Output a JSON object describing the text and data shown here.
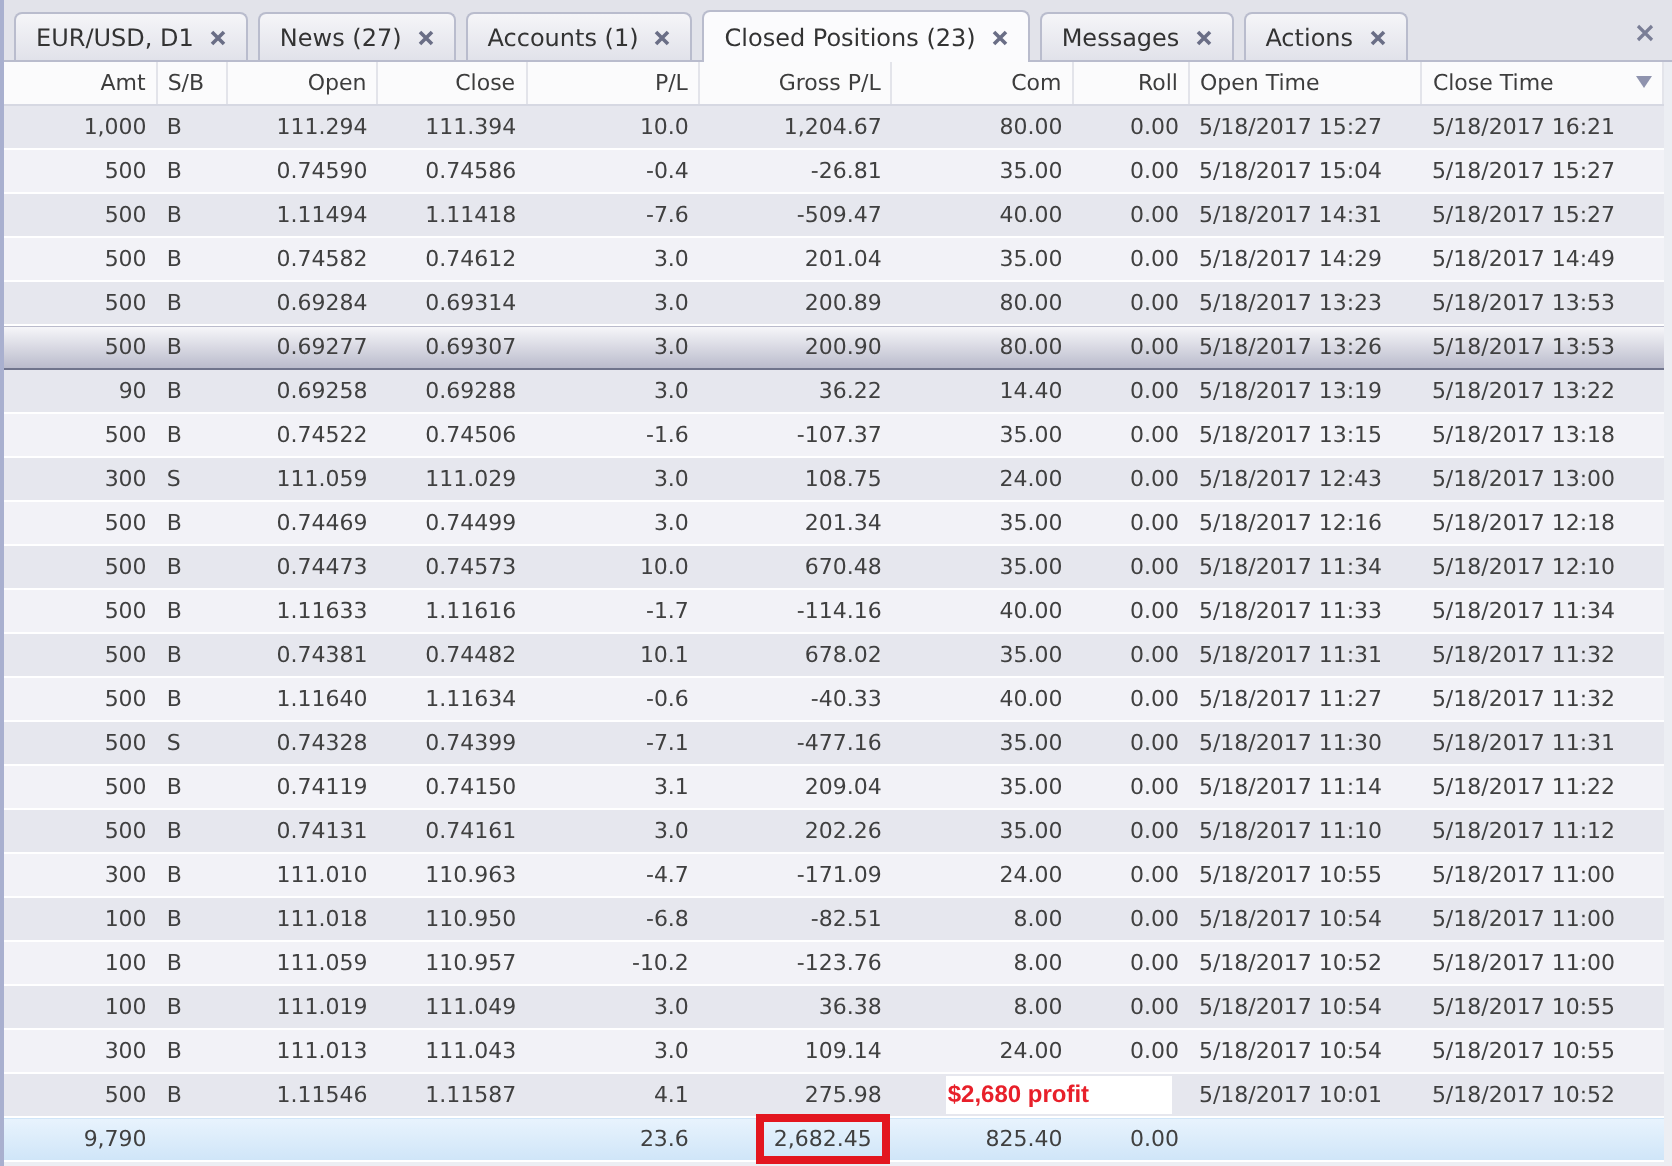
{
  "tabs": [
    {
      "label": "EUR/USD, D1",
      "selected": false
    },
    {
      "label": "News (27)",
      "selected": false
    },
    {
      "label": "Accounts (1)",
      "selected": false
    },
    {
      "label": "Closed Positions (23)",
      "selected": true
    },
    {
      "label": "Messages",
      "selected": false
    },
    {
      "label": "Actions",
      "selected": false
    }
  ],
  "table": {
    "columns": [
      {
        "label": "Amt",
        "sorted": false
      },
      {
        "label": "S/B",
        "sorted": false
      },
      {
        "label": "Open",
        "sorted": false
      },
      {
        "label": "Close",
        "sorted": false
      },
      {
        "label": "P/L",
        "sorted": false
      },
      {
        "label": "Gross P/L",
        "sorted": false
      },
      {
        "label": "Com",
        "sorted": false
      },
      {
        "label": "Roll",
        "sorted": false
      },
      {
        "label": "Open Time",
        "sorted": false
      },
      {
        "label": "Close Time",
        "sorted": true
      }
    ],
    "rows": [
      {
        "amt": "1,000",
        "side": "B",
        "open": "111.294",
        "close": "111.394",
        "pl": "10.0",
        "gross_pl": "1,204.67",
        "com": "80.00",
        "roll": "0.00",
        "open_time": "5/18/2017 15:27",
        "close_time": "5/18/2017 16:21",
        "selected": false
      },
      {
        "amt": "500",
        "side": "B",
        "open": "0.74590",
        "close": "0.74586",
        "pl": "-0.4",
        "gross_pl": "-26.81",
        "com": "35.00",
        "roll": "0.00",
        "open_time": "5/18/2017 15:04",
        "close_time": "5/18/2017 15:27",
        "selected": false
      },
      {
        "amt": "500",
        "side": "B",
        "open": "1.11494",
        "close": "1.11418",
        "pl": "-7.6",
        "gross_pl": "-509.47",
        "com": "40.00",
        "roll": "0.00",
        "open_time": "5/18/2017 14:31",
        "close_time": "5/18/2017 15:27",
        "selected": false
      },
      {
        "amt": "500",
        "side": "B",
        "open": "0.74582",
        "close": "0.74612",
        "pl": "3.0",
        "gross_pl": "201.04",
        "com": "35.00",
        "roll": "0.00",
        "open_time": "5/18/2017 14:29",
        "close_time": "5/18/2017 14:49",
        "selected": false
      },
      {
        "amt": "500",
        "side": "B",
        "open": "0.69284",
        "close": "0.69314",
        "pl": "3.0",
        "gross_pl": "200.89",
        "com": "80.00",
        "roll": "0.00",
        "open_time": "5/18/2017 13:23",
        "close_time": "5/18/2017 13:53",
        "selected": false
      },
      {
        "amt": "500",
        "side": "B",
        "open": "0.69277",
        "close": "0.69307",
        "pl": "3.0",
        "gross_pl": "200.90",
        "com": "80.00",
        "roll": "0.00",
        "open_time": "5/18/2017 13:26",
        "close_time": "5/18/2017 13:53",
        "selected": true
      },
      {
        "amt": "90",
        "side": "B",
        "open": "0.69258",
        "close": "0.69288",
        "pl": "3.0",
        "gross_pl": "36.22",
        "com": "14.40",
        "roll": "0.00",
        "open_time": "5/18/2017 13:19",
        "close_time": "5/18/2017 13:22",
        "selected": false
      },
      {
        "amt": "500",
        "side": "B",
        "open": "0.74522",
        "close": "0.74506",
        "pl": "-1.6",
        "gross_pl": "-107.37",
        "com": "35.00",
        "roll": "0.00",
        "open_time": "5/18/2017 13:15",
        "close_time": "5/18/2017 13:18",
        "selected": false
      },
      {
        "amt": "300",
        "side": "S",
        "open": "111.059",
        "close": "111.029",
        "pl": "3.0",
        "gross_pl": "108.75",
        "com": "24.00",
        "roll": "0.00",
        "open_time": "5/18/2017 12:43",
        "close_time": "5/18/2017 13:00",
        "selected": false
      },
      {
        "amt": "500",
        "side": "B",
        "open": "0.74469",
        "close": "0.74499",
        "pl": "3.0",
        "gross_pl": "201.34",
        "com": "35.00",
        "roll": "0.00",
        "open_time": "5/18/2017 12:16",
        "close_time": "5/18/2017 12:18",
        "selected": false
      },
      {
        "amt": "500",
        "side": "B",
        "open": "0.74473",
        "close": "0.74573",
        "pl": "10.0",
        "gross_pl": "670.48",
        "com": "35.00",
        "roll": "0.00",
        "open_time": "5/18/2017 11:34",
        "close_time": "5/18/2017 12:10",
        "selected": false
      },
      {
        "amt": "500",
        "side": "B",
        "open": "1.11633",
        "close": "1.11616",
        "pl": "-1.7",
        "gross_pl": "-114.16",
        "com": "40.00",
        "roll": "0.00",
        "open_time": "5/18/2017 11:33",
        "close_time": "5/18/2017 11:34",
        "selected": false
      },
      {
        "amt": "500",
        "side": "B",
        "open": "0.74381",
        "close": "0.74482",
        "pl": "10.1",
        "gross_pl": "678.02",
        "com": "35.00",
        "roll": "0.00",
        "open_time": "5/18/2017 11:31",
        "close_time": "5/18/2017 11:32",
        "selected": false
      },
      {
        "amt": "500",
        "side": "B",
        "open": "1.11640",
        "close": "1.11634",
        "pl": "-0.6",
        "gross_pl": "-40.33",
        "com": "40.00",
        "roll": "0.00",
        "open_time": "5/18/2017 11:27",
        "close_time": "5/18/2017 11:32",
        "selected": false
      },
      {
        "amt": "500",
        "side": "S",
        "open": "0.74328",
        "close": "0.74399",
        "pl": "-7.1",
        "gross_pl": "-477.16",
        "com": "35.00",
        "roll": "0.00",
        "open_time": "5/18/2017 11:30",
        "close_time": "5/18/2017 11:31",
        "selected": false
      },
      {
        "amt": "500",
        "side": "B",
        "open": "0.74119",
        "close": "0.74150",
        "pl": "3.1",
        "gross_pl": "209.04",
        "com": "35.00",
        "roll": "0.00",
        "open_time": "5/18/2017 11:14",
        "close_time": "5/18/2017 11:22",
        "selected": false
      },
      {
        "amt": "500",
        "side": "B",
        "open": "0.74131",
        "close": "0.74161",
        "pl": "3.0",
        "gross_pl": "202.26",
        "com": "35.00",
        "roll": "0.00",
        "open_time": "5/18/2017 11:10",
        "close_time": "5/18/2017 11:12",
        "selected": false
      },
      {
        "amt": "300",
        "side": "B",
        "open": "111.010",
        "close": "110.963",
        "pl": "-4.7",
        "gross_pl": "-171.09",
        "com": "24.00",
        "roll": "0.00",
        "open_time": "5/18/2017 10:55",
        "close_time": "5/18/2017 11:00",
        "selected": false
      },
      {
        "amt": "100",
        "side": "B",
        "open": "111.018",
        "close": "110.950",
        "pl": "-6.8",
        "gross_pl": "-82.51",
        "com": "8.00",
        "roll": "0.00",
        "open_time": "5/18/2017 10:54",
        "close_time": "5/18/2017 11:00",
        "selected": false
      },
      {
        "amt": "100",
        "side": "B",
        "open": "111.059",
        "close": "110.957",
        "pl": "-10.2",
        "gross_pl": "-123.76",
        "com": "8.00",
        "roll": "0.00",
        "open_time": "5/18/2017 10:52",
        "close_time": "5/18/2017 11:00",
        "selected": false
      },
      {
        "amt": "100",
        "side": "B",
        "open": "111.019",
        "close": "111.049",
        "pl": "3.0",
        "gross_pl": "36.38",
        "com": "8.00",
        "roll": "0.00",
        "open_time": "5/18/2017 10:54",
        "close_time": "5/18/2017 10:55",
        "selected": false
      },
      {
        "amt": "300",
        "side": "B",
        "open": "111.013",
        "close": "111.043",
        "pl": "3.0",
        "gross_pl": "109.14",
        "com": "24.00",
        "roll": "0.00",
        "open_time": "5/18/2017 10:54",
        "close_time": "5/18/2017 10:55",
        "selected": false
      },
      {
        "amt": "500",
        "side": "B",
        "open": "1.11546",
        "close": "1.11587",
        "pl": "4.1",
        "gross_pl": "275.98",
        "open_time": "5/18/2017 10:01",
        "close_time": "5/18/2017 10:52",
        "selected": false,
        "note": "$2,680 profit"
      }
    ],
    "totals": {
      "amt": "9,790",
      "pl": "23.6",
      "gross_pl": "2,682.45",
      "com": "825.40",
      "roll": "0.00",
      "gross_pl_highlighted": true
    }
  }
}
